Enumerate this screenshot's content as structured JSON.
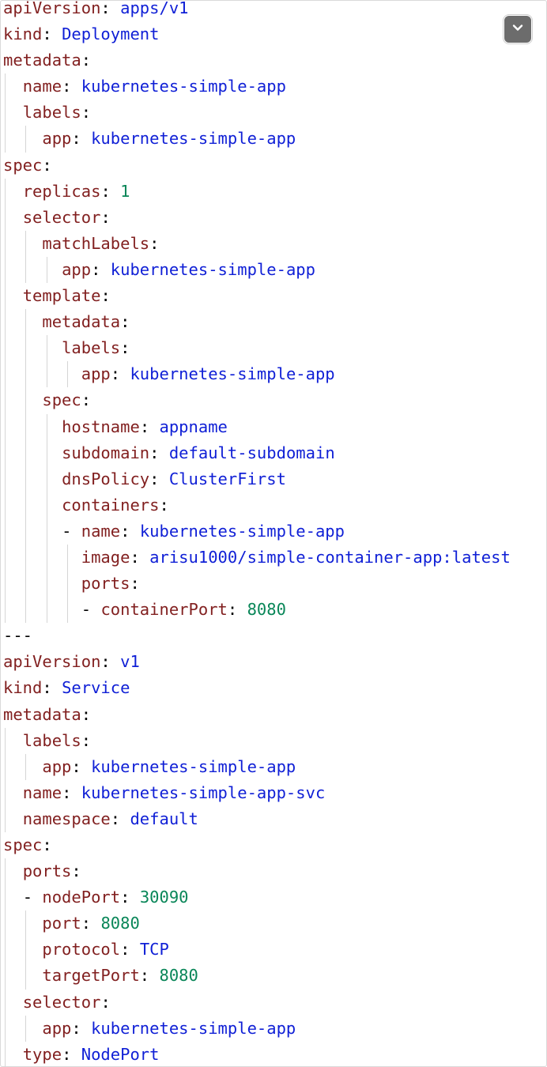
{
  "colors": {
    "key": "#811f1f",
    "string": "#0f1fd6",
    "number": "#098658",
    "punctuation": "#000000",
    "guide": "#d5d5d5",
    "button": "#6c6c6c"
  },
  "toolbar": {
    "collapse_icon": "chevron-down-icon"
  },
  "lines": [
    {
      "indent": 0,
      "key": "apiVersion",
      "value": "apps/v1",
      "vtype": "s"
    },
    {
      "indent": 0,
      "key": "kind",
      "value": "Deployment",
      "vtype": "s"
    },
    {
      "indent": 0,
      "key": "metadata",
      "value": "",
      "vtype": ""
    },
    {
      "indent": 1,
      "key": "name",
      "value": "kubernetes-simple-app",
      "vtype": "s"
    },
    {
      "indent": 1,
      "key": "labels",
      "value": "",
      "vtype": ""
    },
    {
      "indent": 2,
      "key": "app",
      "value": "kubernetes-simple-app",
      "vtype": "s"
    },
    {
      "indent": 0,
      "key": "spec",
      "value": "",
      "vtype": ""
    },
    {
      "indent": 1,
      "key": "replicas",
      "value": "1",
      "vtype": "n"
    },
    {
      "indent": 1,
      "key": "selector",
      "value": "",
      "vtype": ""
    },
    {
      "indent": 2,
      "key": "matchLabels",
      "value": "",
      "vtype": ""
    },
    {
      "indent": 3,
      "key": "app",
      "value": "kubernetes-simple-app",
      "vtype": "s"
    },
    {
      "indent": 1,
      "key": "template",
      "value": "",
      "vtype": ""
    },
    {
      "indent": 2,
      "key": "metadata",
      "value": "",
      "vtype": ""
    },
    {
      "indent": 3,
      "key": "labels",
      "value": "",
      "vtype": ""
    },
    {
      "indent": 4,
      "key": "app",
      "value": "kubernetes-simple-app",
      "vtype": "s"
    },
    {
      "indent": 2,
      "key": "spec",
      "value": "",
      "vtype": ""
    },
    {
      "indent": 3,
      "key": "hostname",
      "value": "appname",
      "vtype": "s"
    },
    {
      "indent": 3,
      "key": "subdomain",
      "value": "default-subdomain",
      "vtype": "s"
    },
    {
      "indent": 3,
      "key": "dnsPolicy",
      "value": "ClusterFirst",
      "vtype": "s"
    },
    {
      "indent": 3,
      "key": "containers",
      "value": "",
      "vtype": ""
    },
    {
      "indent": 3,
      "dash": true,
      "key": "name",
      "value": "kubernetes-simple-app",
      "vtype": "s"
    },
    {
      "indent": 4,
      "key": "image",
      "value": "arisu1000/simple-container-app:latest",
      "vtype": "s"
    },
    {
      "indent": 4,
      "key": "ports",
      "value": "",
      "vtype": ""
    },
    {
      "indent": 4,
      "dash": true,
      "key": "containerPort",
      "value": "8080",
      "vtype": "n"
    },
    {
      "indent": 0,
      "raw": "---"
    },
    {
      "indent": 0,
      "key": "apiVersion",
      "value": "v1",
      "vtype": "s"
    },
    {
      "indent": 0,
      "key": "kind",
      "value": "Service",
      "vtype": "s"
    },
    {
      "indent": 0,
      "key": "metadata",
      "value": "",
      "vtype": ""
    },
    {
      "indent": 1,
      "key": "labels",
      "value": "",
      "vtype": ""
    },
    {
      "indent": 2,
      "key": "app",
      "value": "kubernetes-simple-app",
      "vtype": "s"
    },
    {
      "indent": 1,
      "key": "name",
      "value": "kubernetes-simple-app-svc",
      "vtype": "s"
    },
    {
      "indent": 1,
      "key": "namespace",
      "value": "default",
      "vtype": "s"
    },
    {
      "indent": 0,
      "key": "spec",
      "value": "",
      "vtype": ""
    },
    {
      "indent": 1,
      "key": "ports",
      "value": "",
      "vtype": ""
    },
    {
      "indent": 1,
      "dash": true,
      "key": "nodePort",
      "value": "30090",
      "vtype": "n"
    },
    {
      "indent": 2,
      "key": "port",
      "value": "8080",
      "vtype": "n"
    },
    {
      "indent": 2,
      "key": "protocol",
      "value": "TCP",
      "vtype": "s"
    },
    {
      "indent": 2,
      "key": "targetPort",
      "value": "8080",
      "vtype": "n"
    },
    {
      "indent": 1,
      "key": "selector",
      "value": "",
      "vtype": ""
    },
    {
      "indent": 2,
      "key": "app",
      "value": "kubernetes-simple-app",
      "vtype": "s"
    },
    {
      "indent": 1,
      "key": "type",
      "value": "NodePort",
      "vtype": "s"
    }
  ]
}
